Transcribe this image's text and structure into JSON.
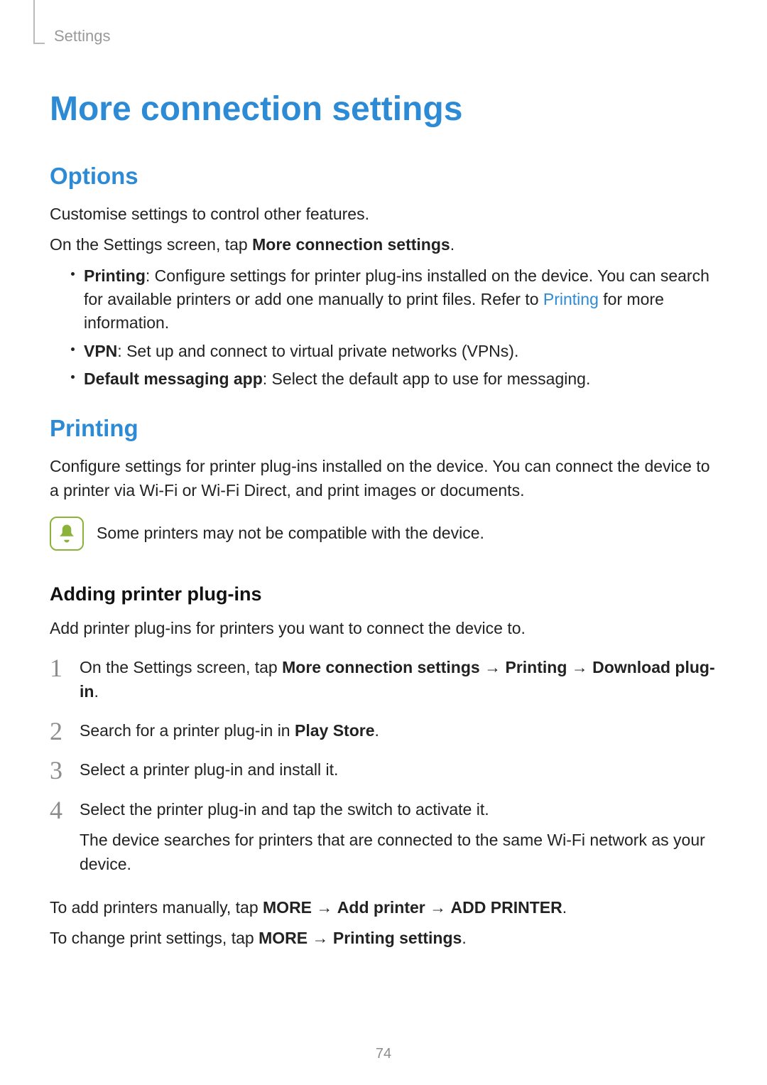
{
  "runningHeader": "Settings",
  "title": "More connection settings",
  "options": {
    "heading": "Options",
    "intro": "Customise settings to control other features.",
    "instruction_pre": "On the Settings screen, tap ",
    "instruction_bold": "More connection settings",
    "instruction_post": ".",
    "bullets": {
      "printing": {
        "label": "Printing",
        "text1": ": Configure settings for printer plug-ins installed on the device. You can search for available printers or add one manually to print files. Refer to ",
        "link": "Printing",
        "text2": " for more information."
      },
      "vpn": {
        "label": "VPN",
        "text": ": Set up and connect to virtual private networks (VPNs)."
      },
      "dma": {
        "label": "Default messaging app",
        "text": ": Select the default app to use for messaging."
      }
    }
  },
  "printing": {
    "heading": "Printing",
    "intro": "Configure settings for printer plug-ins installed on the device. You can connect the device to a printer via Wi-Fi or Wi-Fi Direct, and print images or documents.",
    "note": "Some printers may not be compatible with the device.",
    "subheading": "Adding printer plug-ins",
    "subintro": "Add printer plug-ins for printers you want to connect the device to.",
    "steps": {
      "s1": {
        "pre": "On the Settings screen, tap ",
        "b1": "More connection settings",
        "arrow1": " → ",
        "b2": "Printing",
        "arrow2": " → ",
        "b3": "Download plug-in",
        "post": "."
      },
      "s2": {
        "pre": "Search for a printer plug-in in ",
        "b1": "Play Store",
        "post": "."
      },
      "s3": {
        "text": "Select a printer plug-in and install it."
      },
      "s4": {
        "line1": "Select the printer plug-in and tap the switch to activate it.",
        "line2": "The device searches for printers that are connected to the same Wi-Fi network as your device."
      }
    },
    "tail1": {
      "pre": "To add printers manually, tap ",
      "b1": "MORE",
      "arrow1": " → ",
      "b2": "Add printer",
      "arrow2": " → ",
      "b3": "ADD PRINTER",
      "post": "."
    },
    "tail2": {
      "pre": "To change print settings, tap ",
      "b1": "MORE",
      "arrow1": " → ",
      "b2": "Printing settings",
      "post": "."
    }
  },
  "pageNumber": "74"
}
